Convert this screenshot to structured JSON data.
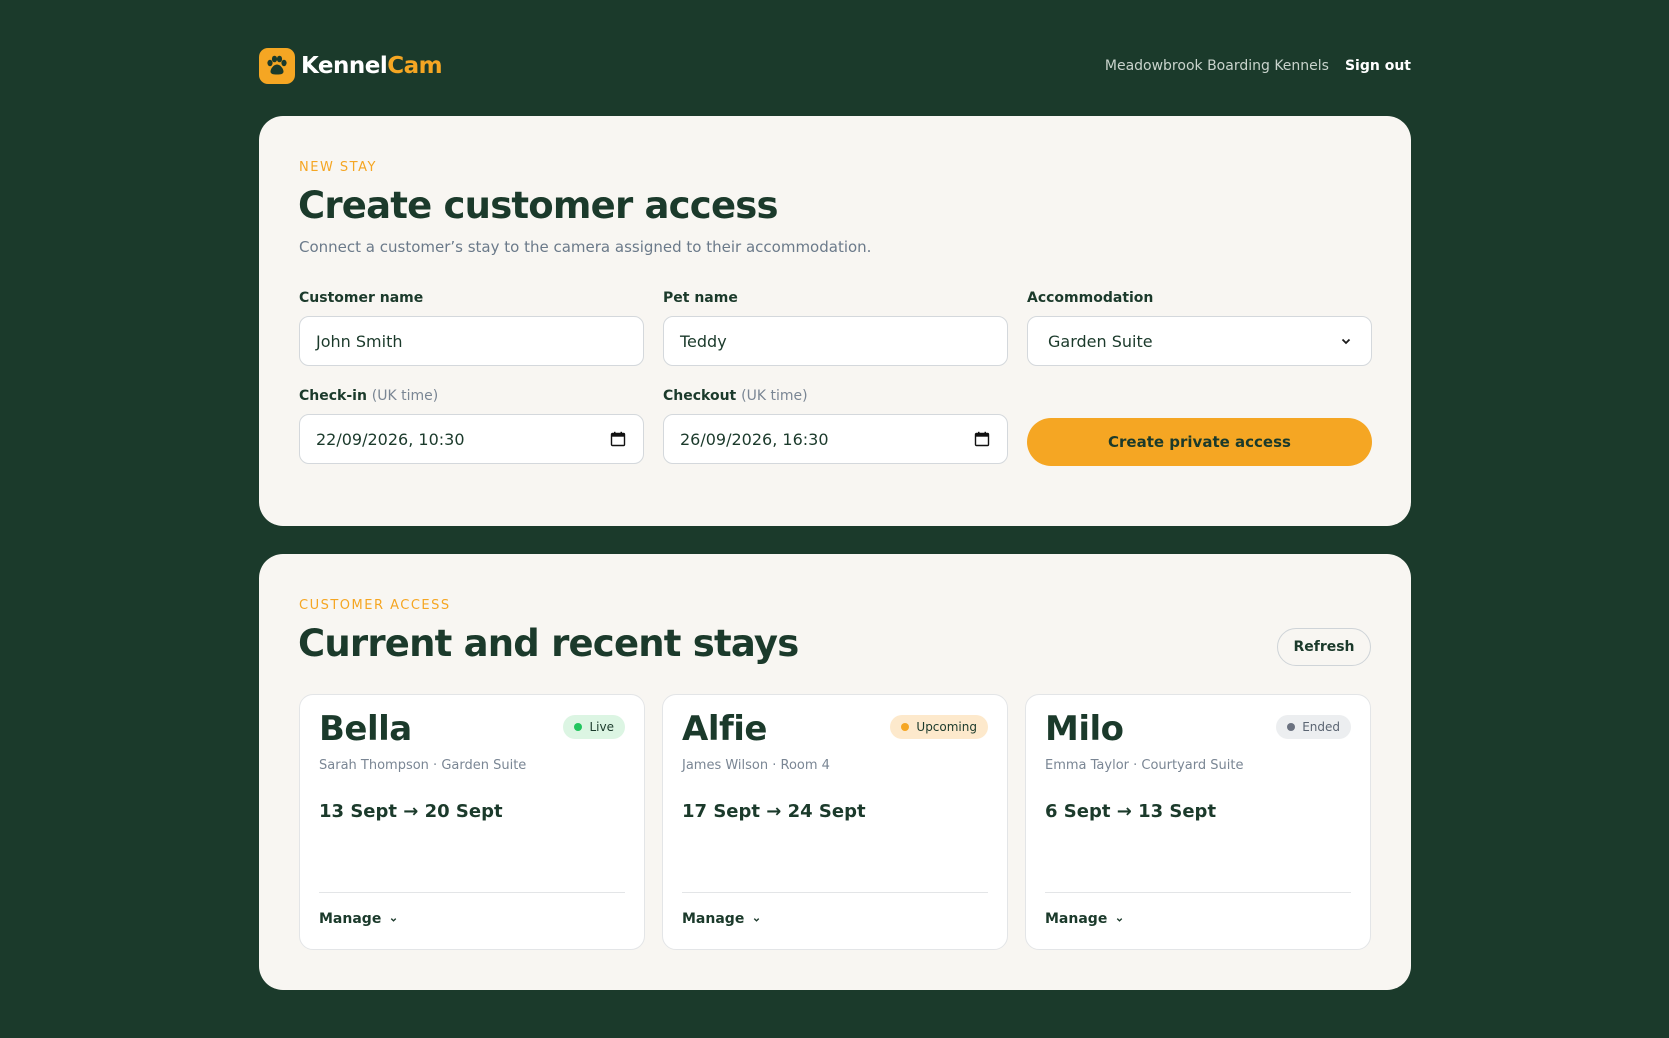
{
  "brand": {
    "name_part1": "Kennel",
    "name_part2": "Cam",
    "icon": "paw-icon"
  },
  "header": {
    "kennel_name": "Meadowbrook Boarding Kennels",
    "sign_out": "Sign out"
  },
  "new_stay": {
    "eyebrow": "NEW STAY",
    "title": "Create customer access",
    "subtitle": "Connect a customer’s stay to the camera assigned to their accommodation.",
    "customer_name": {
      "label": "Customer name",
      "value": "John Smith"
    },
    "pet_name": {
      "label": "Pet name",
      "value": "Teddy"
    },
    "accommodation": {
      "label": "Accommodation",
      "value": "Garden Suite"
    },
    "check_in": {
      "label": "Check-in",
      "note": "(UK time)",
      "value": "22/09/2026, 10:30"
    },
    "checkout": {
      "label": "Checkout",
      "note": "(UK time)",
      "value": "26/09/2026, 16:30"
    },
    "submit_label": "Create private access"
  },
  "stays": {
    "eyebrow": "CUSTOMER ACCESS",
    "title": "Current and recent stays",
    "refresh_label": "Refresh",
    "items": [
      {
        "pet": "Bella",
        "meta": "Sarah Thompson · Garden Suite",
        "dates": "13 Sept → 20 Sept",
        "status": "Live",
        "manage": "Manage"
      },
      {
        "pet": "Alfie",
        "meta": "James Wilson · Room 4",
        "dates": "17 Sept → 24 Sept",
        "status": "Upcoming",
        "manage": "Manage"
      },
      {
        "pet": "Milo",
        "meta": "Emma Taylor · Courtyard Suite",
        "dates": "6 Sept → 13 Sept",
        "status": "Ended",
        "manage": "Manage"
      }
    ]
  },
  "colors": {
    "background": "#1b3a2b",
    "accent": "#f5a623",
    "panel": "#f8f6f2",
    "live": "#22c55e",
    "upcoming": "#f5a623",
    "ended": "#6b7280"
  }
}
